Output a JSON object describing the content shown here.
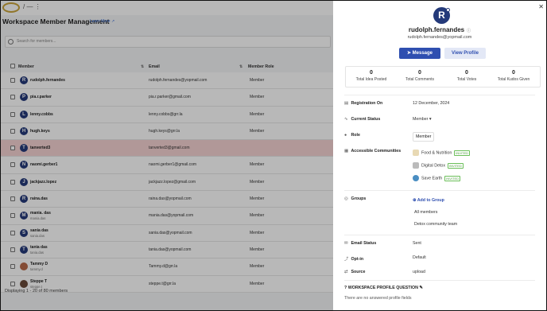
{
  "page": {
    "title": "Workspace Member Management",
    "learn_more": "Learn More",
    "search_placeholder": "Search for members...",
    "columns": {
      "member": "Member",
      "email": "Email",
      "role": "Member Role"
    },
    "rows": [
      {
        "initial": "R",
        "name": "rudolph.fernandes",
        "sub": "",
        "email": "rudolph.fernandes@yopmail.com",
        "role": "Member"
      },
      {
        "initial": "P",
        "name": "pia.r.parker",
        "sub": "",
        "email": "pia.r.parker@gmail.com",
        "role": "Member"
      },
      {
        "initial": "L",
        "name": "lenny.cobbs",
        "sub": "",
        "email": "lenny.cobbs@grr.la",
        "role": "Member"
      },
      {
        "initial": "H",
        "name": "hugh.keys",
        "sub": "",
        "email": "hugh.keys@grr.la",
        "role": "Member"
      },
      {
        "initial": "T",
        "name": "tanverted3",
        "sub": "",
        "email": "tanverted3@gmail.com",
        "role": ""
      },
      {
        "initial": "N",
        "name": "naomi.gerber1",
        "sub": "",
        "email": "naomi.gerber1@gmail.com",
        "role": "Member"
      },
      {
        "initial": "J",
        "name": "jackjazz.lopez",
        "sub": "",
        "email": "jackjazz.lopez@gmail.com",
        "role": "Member"
      },
      {
        "initial": "R",
        "name": "raina.das",
        "sub": "",
        "email": "raina.das@yopmail.com",
        "role": "Member"
      },
      {
        "initial": "M",
        "name": "mania. das",
        "sub": "mania.das",
        "email": "mania.das@yopmail.com",
        "role": "Member"
      },
      {
        "initial": "S",
        "name": "sania das",
        "sub": "sania.das",
        "email": "sania.das@yopmail.com",
        "role": "Member"
      },
      {
        "initial": "T",
        "name": "tania das",
        "sub": "tania.das",
        "email": "tania.das@yopmail.com",
        "role": "Member"
      },
      {
        "initial": "",
        "name": "Tammy D",
        "sub": "tammy.d",
        "email": "Tammy.d@grr.la",
        "role": "Member"
      },
      {
        "initial": "",
        "name": "Steppe T",
        "sub": "steppe.t",
        "email": "steppe.t@grr.la",
        "role": "Member"
      }
    ],
    "footer": "Displaying 1 - 20 of 80 members"
  },
  "profile": {
    "initial": "R",
    "username": "rudolph.fernandes",
    "email": "rudolph.fernandes@yopmail.com",
    "message_btn": "Message",
    "view_profile_btn": "View Profile",
    "stats": [
      {
        "value": "0",
        "label": "Total Idea Posted"
      },
      {
        "value": "0",
        "label": "Total Comments"
      },
      {
        "value": "0",
        "label": "Total Votes"
      },
      {
        "value": "0",
        "label": "Total Kudos Given"
      }
    ],
    "registration_label": "Registration On",
    "registration_value": "12 December, 2024",
    "status_label": "Current Status",
    "status_value": "Member",
    "role_label": "Role",
    "role_value": "Member",
    "communities_label": "Accessible Communities",
    "communities": [
      {
        "name": "Food & Nutrition",
        "badge": "INVITED"
      },
      {
        "name": "Digital Detox",
        "badge": "INVITED"
      },
      {
        "name": "Save Earth",
        "badge": "INVITED"
      }
    ],
    "groups_label": "Groups",
    "add_group": "Add to Group",
    "groups": [
      "All members",
      "Detox community team"
    ],
    "email_status_label": "Email Status",
    "email_status_value": "Sent",
    "optin_label": "Opt-in",
    "optin_value": "Default",
    "source_label": "Source",
    "source_value": "upload",
    "wpq_label": "WORKSPACE PROFILE QUESTION",
    "wpq_empty": "There are no answered profile fields"
  },
  "colors": {
    "primary": "#2f4fb0",
    "avatar": "#243a7a",
    "highlight_row": "#f6d3d3",
    "invited": "#4a9a3a"
  }
}
